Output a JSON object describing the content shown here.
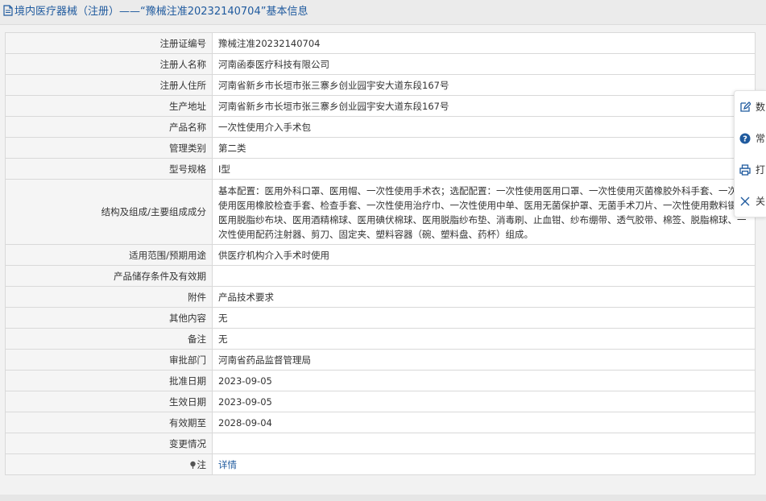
{
  "header": {
    "title": "境内医疗器械（注册）——“豫械注准20232140704”基本信息"
  },
  "rows": [
    {
      "label": "注册证编号",
      "value": "豫械注准20232140704"
    },
    {
      "label": "注册人名称",
      "value": "河南函泰医疗科技有限公司"
    },
    {
      "label": "注册人住所",
      "value": "河南省新乡市长垣市张三寨乡创业园宇安大道东段167号"
    },
    {
      "label": "生产地址",
      "value": "河南省新乡市长垣市张三寨乡创业园宇安大道东段167号"
    },
    {
      "label": "产品名称",
      "value": "一次性使用介入手术包"
    },
    {
      "label": "管理类别",
      "value": "第二类"
    },
    {
      "label": "型号规格",
      "value": "I型"
    },
    {
      "label": "结构及组成/主要组成成分",
      "value": "基本配置：医用外科口罩、医用帽、一次性使用手术衣；选配配置：一次性使用医用口罩、一次性使用灭菌橡胶外科手套、一次性使用医用橡胶检查手套、检查手套、一次性使用治疗巾、一次性使用中单、医用无菌保护罩、无菌手术刀片、一次性使用敷料镊、医用脱脂纱布块、医用酒精棉球、医用碘伏棉球、医用脱脂纱布垫、消毒刷、止血钳、纱布绷带、透气胶带、棉签、脱脂棉球、一次性使用配药注射器、剪刀、固定夹、塑料容器（碗、塑料盘、药杯）组成。"
    },
    {
      "label": "适用范围/预期用途",
      "value": "供医疗机构介入手术时使用"
    },
    {
      "label": "产品储存条件及有效期",
      "value": ""
    },
    {
      "label": "附件",
      "value": "产品技术要求"
    },
    {
      "label": "其他内容",
      "value": "无"
    },
    {
      "label": "备注",
      "value": "无"
    },
    {
      "label": "审批部门",
      "value": "河南省药品监督管理局"
    },
    {
      "label": "批准日期",
      "value": "2023-09-05"
    },
    {
      "label": "生效日期",
      "value": "2023-09-05"
    },
    {
      "label": "有效期至",
      "value": "2028-09-04"
    },
    {
      "label": "变更情况",
      "value": ""
    },
    {
      "label": "注",
      "value": "详情"
    }
  ],
  "float_menu": [
    {
      "icon": "edit-icon",
      "label": "数"
    },
    {
      "icon": "help-icon",
      "label": "常"
    },
    {
      "icon": "print-icon",
      "label": "打"
    },
    {
      "icon": "close-icon",
      "label": "关"
    }
  ],
  "colors": {
    "link": "#1f5a9e",
    "label_bg": "#f5f5f5",
    "border": "#d9d9d9"
  }
}
